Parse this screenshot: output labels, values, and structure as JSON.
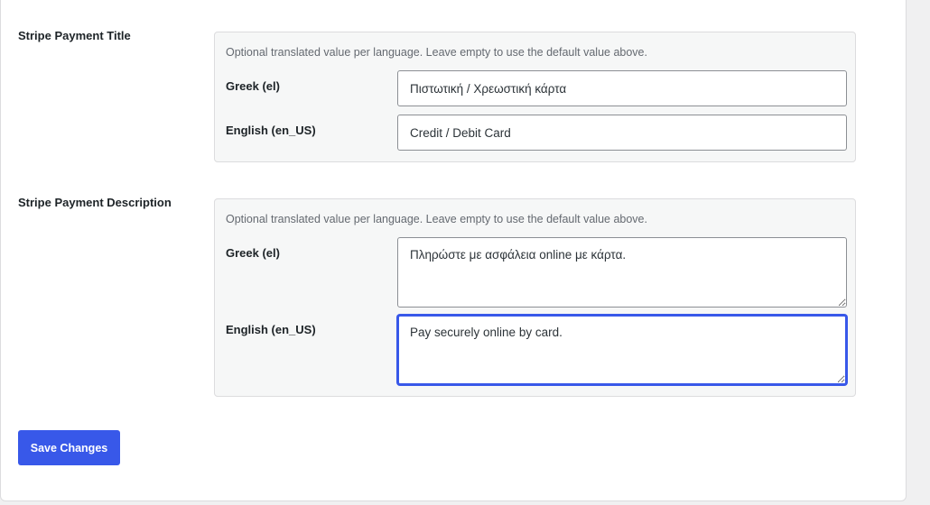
{
  "fields": [
    {
      "label": "Stripe Payment Title",
      "hint": "Optional translated value per language. Leave empty to use the default value above.",
      "translations": [
        {
          "language": "Greek (el)",
          "value": "Πιστωτική / Χρεωστική κάρτα"
        },
        {
          "language": "English (en_US)",
          "value": "Credit / Debit Card"
        }
      ]
    },
    {
      "label": "Stripe Payment Description",
      "hint": "Optional translated value per language. Leave empty to use the default value above.",
      "translations": [
        {
          "language": "Greek (el)",
          "value": "Πληρώστε με ασφάλεια online με κάρτα."
        },
        {
          "language": "English (en_US)",
          "value": "Pay securely online by card."
        }
      ]
    }
  ],
  "actions": {
    "save_label": "Save Changes"
  },
  "colors": {
    "accent": "#3858e9",
    "panel_bg": "#f6f7f7",
    "page_bg": "#f0f0f1"
  }
}
